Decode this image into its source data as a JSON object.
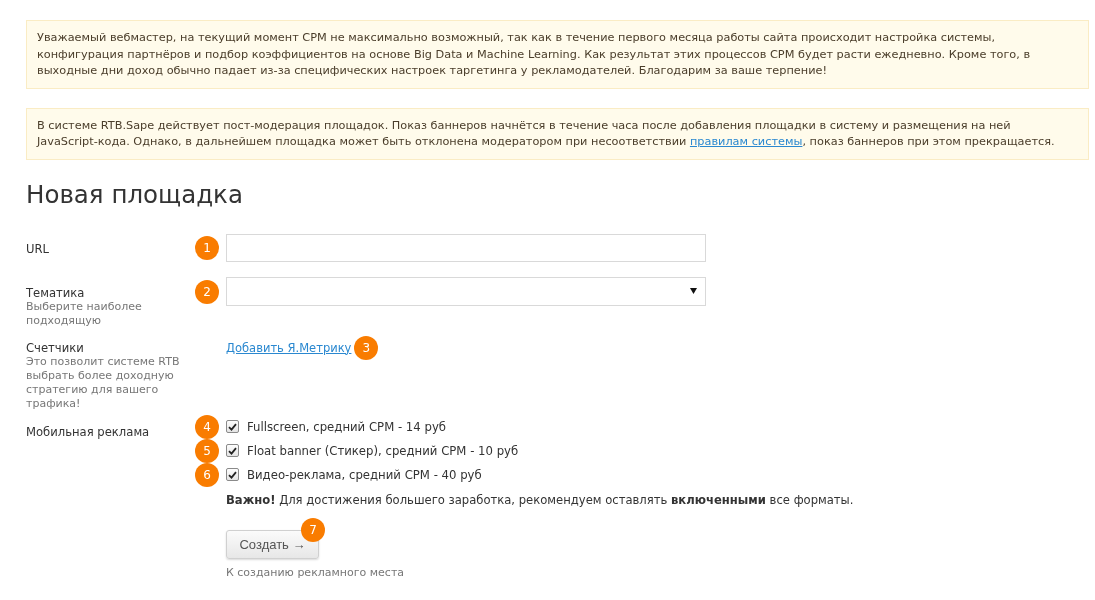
{
  "notices": [
    {
      "parts": [
        {
          "kind": "text",
          "text": "Уважаемый вебмастер, на текущий момент CPM не максимально возможный, так как в течение первого месяца работы сайта происходит настройка системы, конфигурация партнёров и подбор коэффициентов на основе Big Data и Machine Learning. Как результат этих процессов CPM будет расти ежедневно. Кроме того, в выходные дни доход обычно падает из-за специфических настроек таргетинга у рекламодателей. Благодарим за ваше терпение!"
        }
      ]
    },
    {
      "parts": [
        {
          "kind": "text",
          "text": "В системе RTB.Sape действует пост-модерация площадок. Показ баннеров начнётся в течение часа после добавления площадки в систему и размещения на ней JavaScript-кода. Однако, в дальнейшем площадка может быть отклонена модератором при несоответствии "
        },
        {
          "kind": "link",
          "text": "правилам системы"
        },
        {
          "kind": "text",
          "text": ", показ баннеров при этом прекращается."
        }
      ]
    }
  ],
  "heading": "Новая площадка",
  "fields": [
    {
      "kind": "input",
      "label": "URL",
      "marker": "1"
    },
    {
      "kind": "select",
      "label": "Тематика",
      "hint": "Выберите наиболее подходящую",
      "marker": "2"
    },
    {
      "kind": "link",
      "label": "Счетчики",
      "hint": "Это позволит системе RTB выбрать более доходную стратегию для вашего трафика!",
      "link": "Добавить Я.Метрику",
      "marker": "3"
    },
    {
      "kind": "checkboxes",
      "label": "Мобильная реклама",
      "options": [
        {
          "label": "Fullscreen, средний CPM - 14 руб",
          "checked": true,
          "marker": "4"
        },
        {
          "label": "Float banner (Стикер), средний CPM - 10 руб",
          "checked": true,
          "marker": "5"
        },
        {
          "label": "Видео-реклама, средний CPM - 40 руб",
          "checked": true,
          "marker": "6"
        }
      ],
      "note": "**Важно!** Для достижения большего заработка, рекомендуем оставлять **включенными** все форматы."
    }
  ],
  "submit": {
    "label": "Создать →",
    "marker": "7",
    "hint": "К созданию рекламного места"
  }
}
